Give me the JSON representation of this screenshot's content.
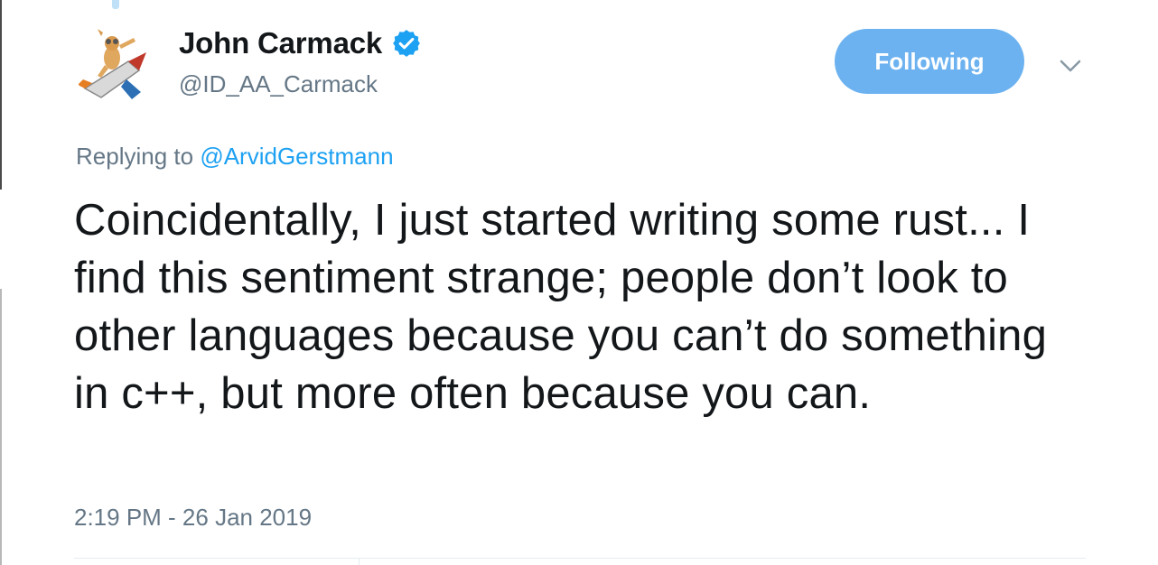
{
  "tweet": {
    "author_name": "John Carmack",
    "author_handle": "@ID_AA_Carmack",
    "verified": true,
    "follow_button_label": "Following",
    "reply_prefix": "Replying to",
    "reply_to_handle": "@ArvidGerstmann",
    "text": "Coincidentally, I just started writing some rust... I find this sentiment strange; people don’t look to other languages because you can’t do something in c++, but more often because you can.",
    "timestamp": "2:19 PM - 26 Jan 2019"
  },
  "icons": {
    "verified": "verified-badge-icon",
    "menu": "chevron-down-icon",
    "avatar": "avatar-image"
  },
  "colors": {
    "follow_button_bg": "#6cb2f0",
    "link": "#1da1f2",
    "secondary_text": "#657786",
    "primary_text": "#14171a",
    "verified_badge": "#1da1f2"
  }
}
